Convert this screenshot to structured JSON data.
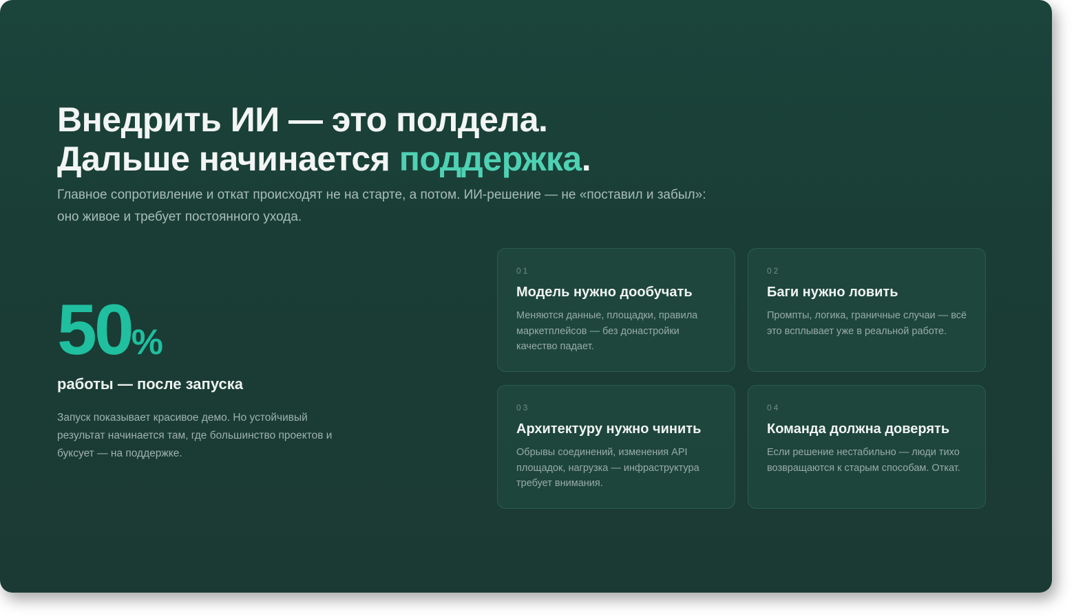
{
  "headline": {
    "line1": "Внедрить ИИ — это полдела.",
    "line2_prefix": "Дальше начинается ",
    "line2_accent": "поддержка",
    "line2_suffix": "."
  },
  "subtitle": "Главное сопротивление и откат происходят не на старте, а потом. ИИ-решение — не «поставил и забыл»: оно живое и требует постоянного ухода.",
  "stat": {
    "value": "50",
    "unit": "%",
    "caption": "работы — после запуска",
    "description": "Запуск показывает красивое демо. Но устойчивый результат начинается там, где большинство проектов и буксует — на поддержке."
  },
  "cards": [
    {
      "index": "01",
      "title": "Модель нужно дообучать",
      "text": "Меняются данные, площадки, правила маркетплейсов — без донастройки качество падает."
    },
    {
      "index": "02",
      "title": "Баги нужно ловить",
      "text": "Промпты, логика, граничные случаи — всё это всплывает уже в реальной работе."
    },
    {
      "index": "03",
      "title": "Архитектуру нужно чинить",
      "text": "Обрывы соединений, изменения API площадок, нагрузка — инфраструктура требует внимания."
    },
    {
      "index": "04",
      "title": "Команда должна доверять",
      "text": "Если решение нестабильно — люди тихо возвращаются к старым способам. Откат."
    }
  ],
  "colors": {
    "background": "#1b4139",
    "accent": "#4fd1b3",
    "stat": "#1fbf9f",
    "card_border": "#2b5c50"
  }
}
